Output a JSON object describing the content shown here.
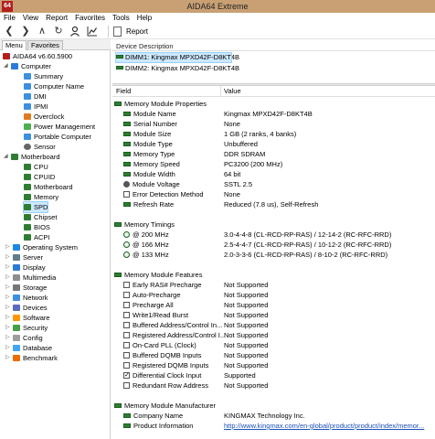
{
  "window": {
    "title": "AIDA64 Extreme",
    "app_icon_text": "64"
  },
  "menu": [
    "File",
    "View",
    "Report",
    "Favorites",
    "Tools",
    "Help"
  ],
  "toolbar": {
    "report_label": "Report"
  },
  "panel_tabs": {
    "menu": "Menu",
    "favorites": "Favorites"
  },
  "tree": {
    "root": "AIDA64 v6.60.5900",
    "computer": {
      "label": "Computer",
      "children": [
        "Summary",
        "Computer Name",
        "DMI",
        "IPMI",
        "Overclock",
        "Power Management",
        "Portable Computer",
        "Sensor"
      ]
    },
    "motherboard": {
      "label": "Motherboard",
      "children": [
        "CPU",
        "CPUID",
        "Motherboard",
        "Memory",
        "SPD",
        "Chipset",
        "BIOS",
        "ACPI"
      ]
    },
    "groups": [
      "Operating System",
      "Server",
      "Display",
      "Multimedia",
      "Storage",
      "Network",
      "Devices",
      "Software",
      "Security",
      "Config",
      "Database",
      "Benchmark"
    ]
  },
  "device_panel": {
    "header": "Device Description",
    "devices": [
      "DIMM1: Kingmax MPXD42F-D8KT4B",
      "DIMM2: Kingmax MPXD42F-D8KT4B"
    ]
  },
  "columns": {
    "field": "Field",
    "value": "Value"
  },
  "sections": {
    "properties": {
      "title": "Memory Module Properties",
      "rows": [
        {
          "field": "Module Name",
          "value": "Kingmax MPXD42F-D8KT4B"
        },
        {
          "field": "Serial Number",
          "value": "None"
        },
        {
          "field": "Module Size",
          "value": "1 GB (2 ranks, 4 banks)"
        },
        {
          "field": "Module Type",
          "value": "Unbuffered"
        },
        {
          "field": "Memory Type",
          "value": "DDR SDRAM"
        },
        {
          "field": "Memory Speed",
          "value": "PC3200 (200 MHz)"
        },
        {
          "field": "Module Width",
          "value": "64 bit"
        },
        {
          "field": "Module Voltage",
          "value": "SSTL 2.5"
        },
        {
          "field": "Error Detection Method",
          "value": "None"
        },
        {
          "field": "Refresh Rate",
          "value": "Reduced (7.8 us), Self-Refresh"
        }
      ]
    },
    "timings": {
      "title": "Memory Timings",
      "rows": [
        {
          "field": "@ 200 MHz",
          "value": "3.0-4-4-8  (CL-RCD-RP-RAS) / 12-14-2  (RC-RFC-RRD)"
        },
        {
          "field": "@ 166 MHz",
          "value": "2.5-4-4-7  (CL-RCD-RP-RAS) / 10-12-2  (RC-RFC-RRD)"
        },
        {
          "field": "@ 133 MHz",
          "value": "2.0-3-3-6  (CL-RCD-RP-RAS) / 8-10-2  (RC-RFC-RRD)"
        }
      ]
    },
    "features": {
      "title": "Memory Module Features",
      "rows": [
        {
          "field": "Early RAS# Precharge",
          "value": "Not Supported",
          "checked": false
        },
        {
          "field": "Auto-Precharge",
          "value": "Not Supported",
          "checked": false
        },
        {
          "field": "Precharge All",
          "value": "Not Supported",
          "checked": false
        },
        {
          "field": "Write1/Read Burst",
          "value": "Not Supported",
          "checked": false
        },
        {
          "field": "Buffered Address/Control In...",
          "value": "Not Supported",
          "checked": false
        },
        {
          "field": "Registered Address/Control I...",
          "value": "Not Supported",
          "checked": false
        },
        {
          "field": "On-Card PLL (Clock)",
          "value": "Not Supported",
          "checked": false
        },
        {
          "field": "Buffered DQMB Inputs",
          "value": "Not Supported",
          "checked": false
        },
        {
          "field": "Registered DQMB Inputs",
          "value": "Not Supported",
          "checked": false
        },
        {
          "field": "Differential Clock Input",
          "value": "Supported",
          "checked": true
        },
        {
          "field": "Redundant Row Address",
          "value": "Not Supported",
          "checked": false
        }
      ]
    },
    "manufacturer": {
      "title": "Memory Module Manufacturer",
      "rows": [
        {
          "field": "Company Name",
          "value": "KINGMAX Technology Inc."
        },
        {
          "field": "Product Information",
          "value": "http://www.kingmax.com/en-global/product/product/index/memor..."
        }
      ]
    }
  },
  "colors": {
    "titlebar": "#c9a074",
    "selection": "#cce8ff",
    "ram_icon": "#2e7d32",
    "link": "#1a4fb8"
  }
}
